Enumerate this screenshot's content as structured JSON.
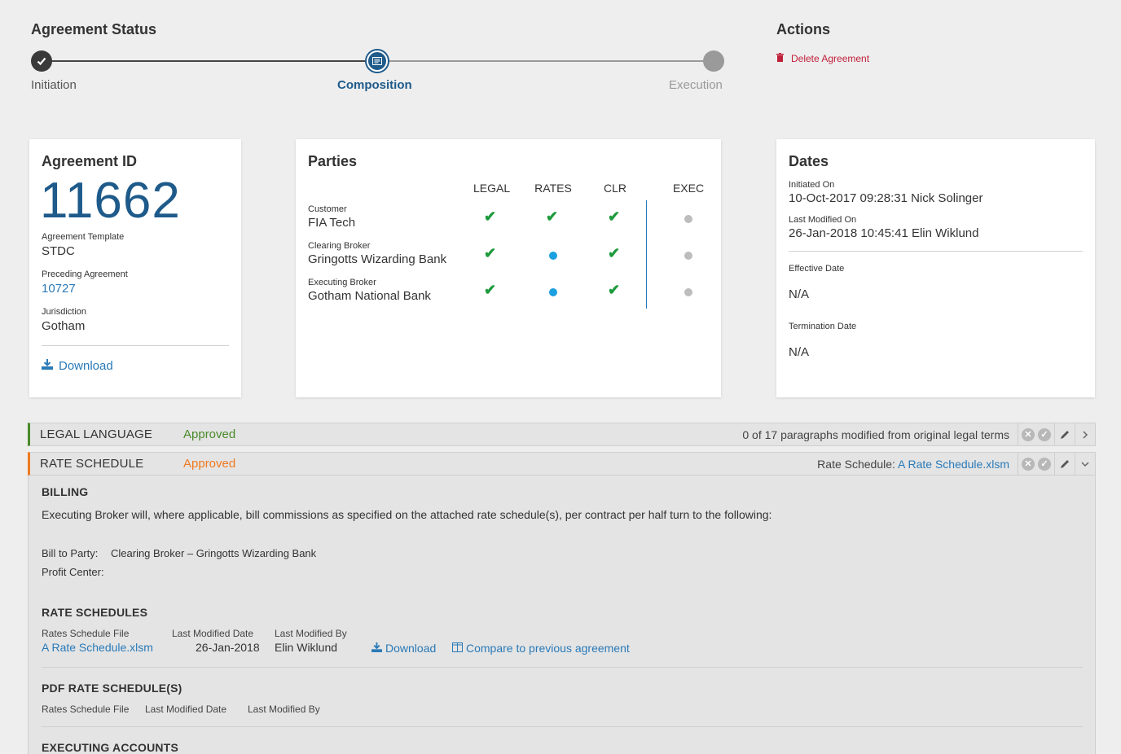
{
  "status": {
    "title": "Agreement Status",
    "steps": [
      "Initiation",
      "Composition",
      "Execution"
    ]
  },
  "actions": {
    "title": "Actions",
    "delete_label": "Delete Agreement"
  },
  "agreement": {
    "title": "Agreement ID",
    "id": "11662",
    "template_label": "Agreement Template",
    "template_value": "STDC",
    "preceding_label": "Preceding Agreement",
    "preceding_value": "10727",
    "jurisdiction_label": "Jurisdiction",
    "jurisdiction_value": "Gotham",
    "download_label": "Download"
  },
  "parties": {
    "title": "Parties",
    "columns": [
      "LEGAL",
      "RATES",
      "CLR",
      "EXEC"
    ],
    "rows": [
      {
        "role": "Customer",
        "name": "FIA Tech",
        "legal": "check",
        "rates": "check",
        "clr": "check",
        "exec": "grey-dot"
      },
      {
        "role": "Clearing Broker",
        "name": "Gringotts Wizarding Bank",
        "legal": "check",
        "rates": "blue-dot",
        "clr": "check",
        "exec": "grey-dot"
      },
      {
        "role": "Executing Broker",
        "name": "Gotham National Bank",
        "legal": "check",
        "rates": "blue-dot",
        "clr": "check",
        "exec": "grey-dot"
      }
    ]
  },
  "dates": {
    "title": "Dates",
    "initiated_label": "Initiated On",
    "initiated_value": "10-Oct-2017 09:28:31 Nick Solinger",
    "modified_label": "Last Modified On",
    "modified_value": "26-Jan-2018 10:45:41 Elin Wiklund",
    "effective_label": "Effective Date",
    "effective_value": "N/A",
    "termination_label": "Termination Date",
    "termination_value": "N/A"
  },
  "legal": {
    "title": "LEGAL LANGUAGE",
    "status": "Approved",
    "status_color": "#4a8a2a",
    "summary": "0 of 17 paragraphs modified from original legal terms"
  },
  "rate": {
    "title": "RATE SCHEDULE",
    "status": "Approved",
    "status_color": "#f07a20",
    "summary_label": "Rate Schedule:",
    "summary_link": "A Rate Schedule.xlsm"
  },
  "billing": {
    "title": "BILLING",
    "text": "Executing Broker will, where applicable, bill commissions as specified on the attached rate schedule(s), per contract per half turn to the following:",
    "bill_to_label": "Bill to Party:",
    "bill_to_value": "Clearing Broker – Gringotts Wizarding Bank",
    "profit_label": "Profit Center:"
  },
  "rate_schedules": {
    "title": "RATE SCHEDULES",
    "headers": [
      "Rates Schedule File",
      "Last Modified Date",
      "Last Modified By"
    ],
    "file": "A Rate Schedule.xlsm",
    "date": "26-Jan-2018",
    "by": "Elin Wiklund",
    "download_label": "Download",
    "compare_label": "Compare to previous agreement"
  },
  "pdf": {
    "title": "PDF RATE SCHEDULE(S)",
    "headers": [
      "Rates Schedule File",
      "Last Modified Date",
      "Last Modified By"
    ]
  },
  "exec_accounts": {
    "title": "EXECUTING ACCOUNTS"
  }
}
